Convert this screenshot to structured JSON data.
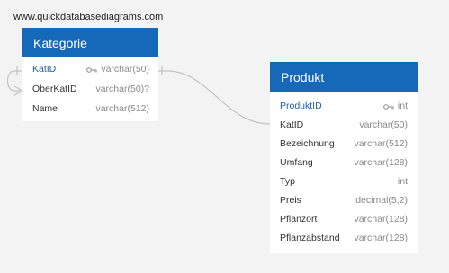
{
  "site": {
    "label": "www.quickdatabasediagrams.com"
  },
  "tables": {
    "kategorie": {
      "title": "Kategorie",
      "header_color": "#1669b8",
      "columns": [
        {
          "name": "KatID",
          "type": "varchar(50)",
          "primary_key": true
        },
        {
          "name": "OberKatID",
          "type": "varchar(50)?",
          "primary_key": false
        },
        {
          "name": "Name",
          "type": "varchar(512)",
          "primary_key": false
        }
      ]
    },
    "produkt": {
      "title": "Produkt",
      "header_color": "#1669b8",
      "columns": [
        {
          "name": "ProduktID",
          "type": "int",
          "primary_key": true
        },
        {
          "name": "KatID",
          "type": "varchar(50)",
          "primary_key": false
        },
        {
          "name": "Bezeichnung",
          "type": "varchar(512)",
          "primary_key": false
        },
        {
          "name": "Umfang",
          "type": "varchar(128)",
          "primary_key": false
        },
        {
          "name": "Typ",
          "type": "int",
          "primary_key": false
        },
        {
          "name": "Preis",
          "type": "decimal(5,2)",
          "primary_key": false
        },
        {
          "name": "Pflanzort",
          "type": "varchar(128)",
          "primary_key": false
        },
        {
          "name": "Pflanzabstand",
          "type": "varchar(128)",
          "primary_key": false
        }
      ]
    }
  },
  "relations": [
    {
      "from": "kategorie.KatID",
      "to": "produkt.KatID"
    },
    {
      "from": "kategorie.OberKatID",
      "to": "kategorie.KatID"
    }
  ],
  "icons": {
    "primary_key": "key-icon"
  }
}
